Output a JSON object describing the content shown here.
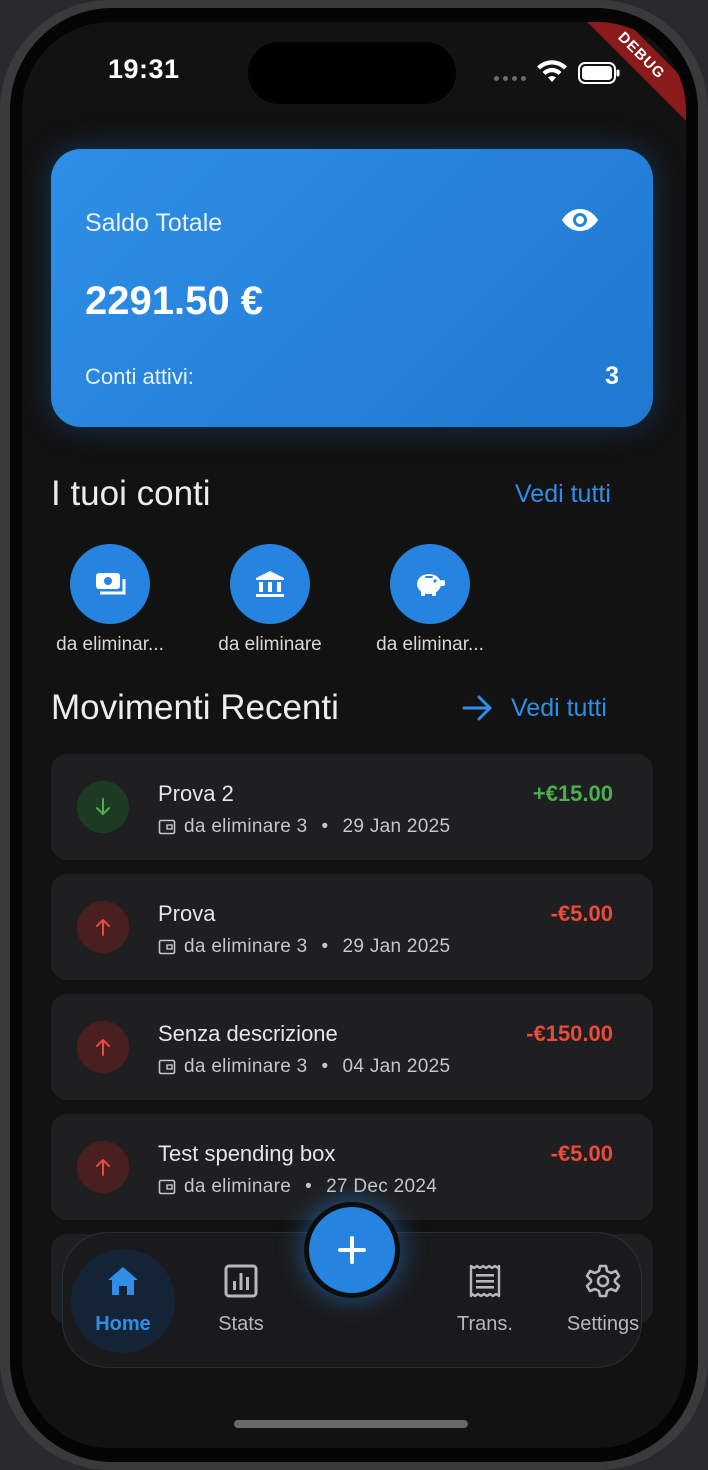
{
  "status_bar": {
    "time": "19:31",
    "debug_label": "DEBUG"
  },
  "balance_card": {
    "label": "Saldo Totale",
    "amount": "2291.50 €",
    "accounts_label": "Conti attivi:",
    "accounts_count": "3",
    "visibility_icon": "eye-icon"
  },
  "accounts_section": {
    "title": "I tuoi conti",
    "see_all": "Vedi tutti",
    "items": [
      {
        "label": "da eliminar...",
        "icon": "cash-icon"
      },
      {
        "label": "da eliminare",
        "icon": "bank-icon"
      },
      {
        "label": "da eliminar...",
        "icon": "piggy-bank-icon"
      }
    ]
  },
  "recent_section": {
    "title": "Movimenti Recenti",
    "see_all": "Vedi tutti",
    "arrow_icon": "arrow-right-icon"
  },
  "transactions": [
    {
      "title": "Prova 2",
      "account": "da eliminare 3",
      "sep": "•",
      "date": "29 Jan 2025",
      "amount": "+€15.00",
      "direction": "in"
    },
    {
      "title": "Prova",
      "account": "da eliminare 3",
      "sep": "•",
      "date": "29 Jan 2025",
      "amount": "-€5.00",
      "direction": "out"
    },
    {
      "title": "Senza descrizione",
      "account": "da eliminare 3",
      "sep": "•",
      "date": "04 Jan 2025",
      "amount": "-€150.00",
      "direction": "out"
    },
    {
      "title": "Test spending box",
      "account": "da eliminare",
      "sep": "•",
      "date": "27 Dec 2024",
      "amount": "-€5.00",
      "direction": "out"
    }
  ],
  "bottom_nav": {
    "items": [
      {
        "label": "Home",
        "icon": "home-icon",
        "active": true
      },
      {
        "label": "Stats",
        "icon": "chart-icon",
        "active": false
      },
      {
        "label": "Trans.",
        "icon": "receipt-icon",
        "active": false
      },
      {
        "label": "Settings",
        "icon": "gear-icon",
        "active": false
      }
    ],
    "fab_icon": "plus-icon"
  },
  "colors": {
    "accent": "#2683e0",
    "positive": "#4caf50",
    "negative": "#e94b3c",
    "background": "#121212"
  }
}
